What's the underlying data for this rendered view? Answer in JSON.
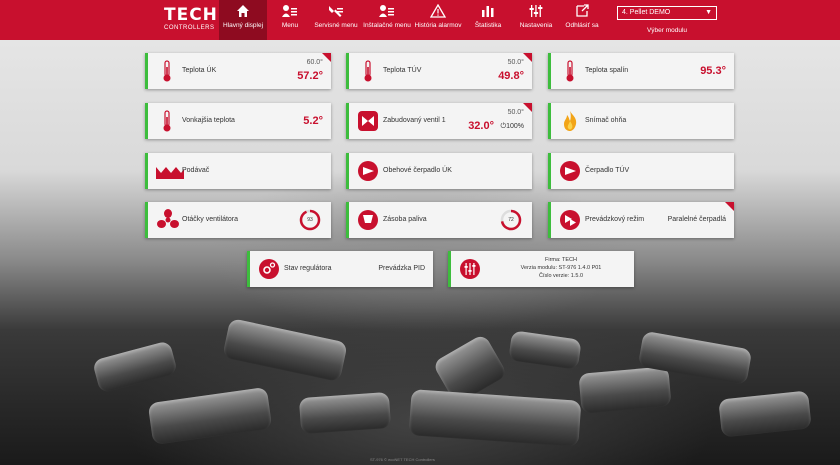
{
  "colors": {
    "brand_red": "#c8102e",
    "active_red": "#8e0b20",
    "status_green": "#3dbd3d"
  },
  "nav": {
    "logo_main": "TECH",
    "logo_sub": "CONTROLLERS",
    "items": [
      {
        "label": "Hlavný displej",
        "icon": "home-icon"
      },
      {
        "label": "Menu",
        "icon": "menu-user-icon"
      },
      {
        "label": "Servisné menu",
        "icon": "tools-icon"
      },
      {
        "label": "Inštalačné menu",
        "icon": "install-user-icon"
      },
      {
        "label": "História alarmov",
        "icon": "warning-icon"
      },
      {
        "label": "Štatistika",
        "icon": "bar-chart-icon"
      },
      {
        "label": "Nastavenia",
        "icon": "sliders-icon"
      },
      {
        "label": "Odhlásiť sa",
        "icon": "logout-icon"
      }
    ],
    "module_value": "4. Pellet DEMO",
    "module_label": "Výber modulu"
  },
  "tiles": {
    "teplota_uk": {
      "label": "Teplota ÚK",
      "set": "60.0°",
      "value": "57.2°"
    },
    "teplota_tuv": {
      "label": "Teplota TÚV",
      "set": "50.0°",
      "value": "49.8°"
    },
    "teplota_spalin": {
      "label": "Teplota spalín",
      "value": "95.3°"
    },
    "vonkajsia": {
      "label": "Vonkajšia teplota",
      "value": "5.2°"
    },
    "ventil": {
      "label": "Zabudovaný ventil 1",
      "set": "50.0°",
      "value": "32.0°",
      "extra": "⏻100%"
    },
    "snimac": {
      "label": "Snímač ohňa"
    },
    "podavac": {
      "label": "Podávač"
    },
    "cerpadlo_uk": {
      "label": "Obehové čerpadlo ÚK"
    },
    "cerpadlo_tuv": {
      "label": "Čerpadlo TÚV"
    },
    "ventilator": {
      "label": "Otáčky ventilátora",
      "gauge_text": "93",
      "gauge_value": 93
    },
    "palivo": {
      "label": "Zásoba paliva",
      "gauge_text": "72",
      "gauge_value": 72
    },
    "rezim": {
      "label": "Prevádzkový režim",
      "value": "Paralelné čerpadlá"
    },
    "stav": {
      "label": "Stav regulátora",
      "value": "Prevádzka PID"
    },
    "info": {
      "line1": "Firma: TECH",
      "line2": "Verzia modulu: ST-976 1.4.0 P01",
      "line3": "Číslo verzie: 1.5.0"
    }
  },
  "footer": {
    "text": "ST-976 © ecoNET TECH Controllers"
  }
}
